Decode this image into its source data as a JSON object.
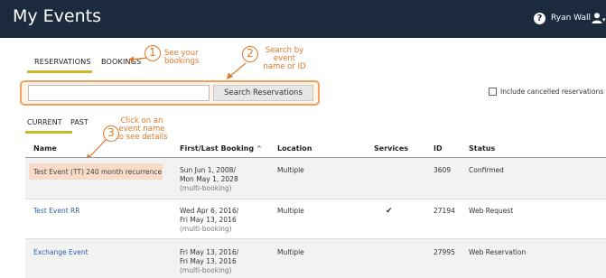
{
  "header": {
    "title": "My Events",
    "help_label": "?",
    "user_name": "Ryan Wall"
  },
  "tabs": {
    "reservations_label": "RESERVATIONS",
    "bookings_label": "BOOKINGS"
  },
  "annotations": {
    "step1": {
      "number": "1",
      "text": "See your bookings"
    },
    "step2": {
      "number": "2",
      "text": "Search by event name or ID"
    },
    "step3": {
      "number": "3",
      "text": "Click on an event name to see details"
    }
  },
  "search": {
    "placeholder": "",
    "value": "",
    "button_label": "Search Reservations"
  },
  "filter": {
    "include_cancelled_label": "Include cancelled reservations",
    "include_cancelled_checked": false
  },
  "subtabs": {
    "current_label": "CURRENT",
    "past_label": "PAST"
  },
  "table": {
    "columns": {
      "name": "Name",
      "first_last": "First/Last Booking",
      "sort_indicator": "^",
      "location": "Location",
      "services": "Services",
      "id": "ID",
      "status": "Status"
    },
    "rows": [
      {
        "name": "Test Event (TT) 240 month recurrence",
        "booking_line1": "Sun Jun 1, 2008/",
        "booking_line2": "Mon May 1, 2028",
        "booking_line3": "(multi-booking)",
        "location": "Multiple",
        "services": "",
        "id": "3609",
        "status": "Confirmed"
      },
      {
        "name": "Test Event RR",
        "booking_line1": "Wed Apr 6, 2016/",
        "booking_line2": "Fri May 13, 2016",
        "booking_line3": "(multi-booking)",
        "location": "Multiple",
        "services": "✔",
        "id": "27194",
        "status": "Web Request"
      },
      {
        "name": "Exchange Event",
        "booking_line1": "Fri May 13, 2016/",
        "booking_line2": "Fri May 13, 2016",
        "booking_line3": "(multi-booking)",
        "location": "Multiple",
        "services": "",
        "id": "27995",
        "status": "Web Reservation"
      }
    ]
  },
  "colors": {
    "header_bg": "#1b2a3d",
    "tab_underline": "#c9b828",
    "annotation": "#e07828",
    "link": "#2a5fa8"
  }
}
